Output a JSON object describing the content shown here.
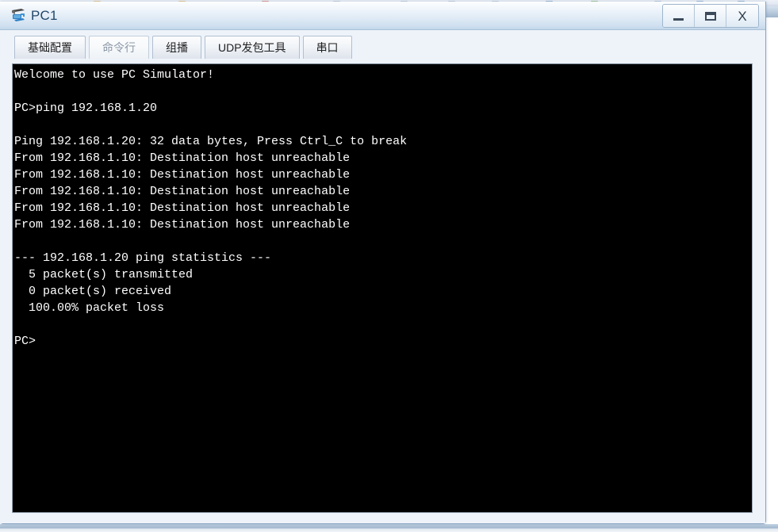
{
  "window": {
    "title": "PC1",
    "icon": "pc-device-icon",
    "controls": [
      {
        "name": "minimize-button",
        "glyph": "—",
        "label": "Minimize"
      },
      {
        "name": "maximize-button",
        "glyph": "▭",
        "label": "Maximize"
      },
      {
        "name": "close-button",
        "glyph": "X",
        "label": "Close"
      }
    ]
  },
  "tabs": [
    {
      "id": "tab-basic-config",
      "label": "基础配置",
      "selected": false
    },
    {
      "id": "tab-command-line",
      "label": "命令行",
      "selected": true
    },
    {
      "id": "tab-multicast",
      "label": "组播",
      "selected": false
    },
    {
      "id": "tab-udp-packet-tool",
      "label": "UDP发包工具",
      "selected": false
    },
    {
      "id": "tab-serial-port",
      "label": "串口",
      "selected": false
    }
  ],
  "console": {
    "background_color": "#000000",
    "text_color": "#ffffff",
    "lines": [
      "Welcome to use PC Simulator!",
      "",
      "PC>ping 192.168.1.20",
      "",
      "Ping 192.168.1.20: 32 data bytes, Press Ctrl_C to break",
      "From 192.168.1.10: Destination host unreachable",
      "From 192.168.1.10: Destination host unreachable",
      "From 192.168.1.10: Destination host unreachable",
      "From 192.168.1.10: Destination host unreachable",
      "From 192.168.1.10: Destination host unreachable",
      "",
      "--- 192.168.1.20 ping statistics ---",
      "  5 packet(s) transmitted",
      "  0 packet(s) received",
      "  100.00% packet loss",
      "",
      "PC>"
    ]
  },
  "theme": {
    "titlebar_accent": "#c3d7ea",
    "window_border": "#8ba7c4",
    "panel_background": "#eef3fa",
    "tab_text": "#1f1f1f",
    "tab_selected_text": "#8b97a6"
  }
}
